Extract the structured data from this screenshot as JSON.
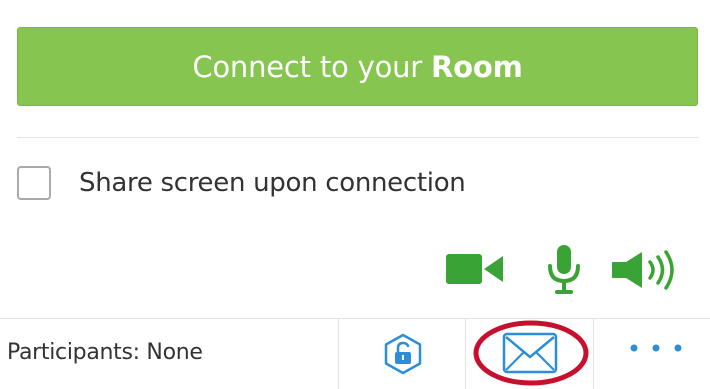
{
  "connect": {
    "label_prefix": "Connect to your ",
    "label_bold": "Room",
    "color": "#86c54f"
  },
  "share": {
    "label": "Share screen upon connection",
    "checked": false
  },
  "media": {
    "icons": [
      "camera-icon",
      "microphone-icon",
      "speaker-icon"
    ],
    "color": "#3aa335"
  },
  "footer": {
    "participants_label": "Participants: None",
    "icons": [
      "lock-icon",
      "mail-icon",
      "more-icon"
    ],
    "accent": "#2d8ed8",
    "highlight": "#c8102e"
  }
}
